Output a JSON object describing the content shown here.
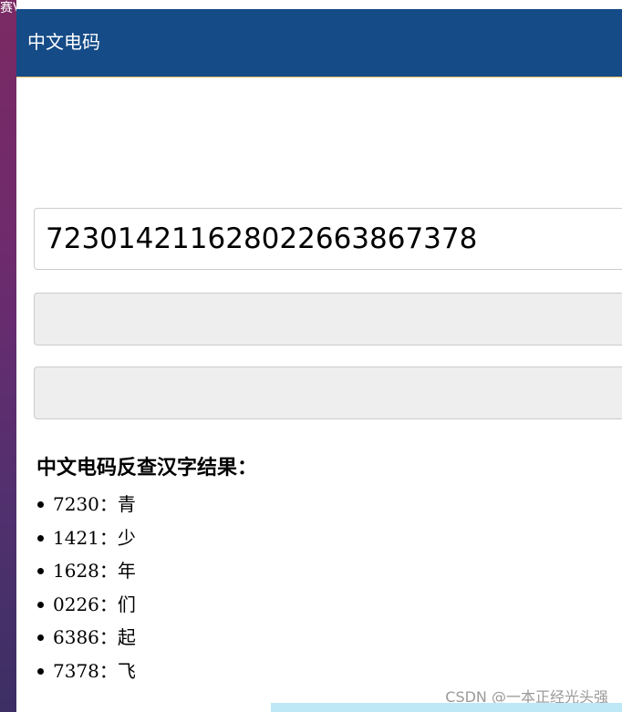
{
  "desktop": {
    "edge_text": "赛V"
  },
  "header": {
    "title": "中文电码",
    "background_color": "#154b86"
  },
  "form": {
    "code_input_value": "72301421162802266386737​8",
    "field2_value": "",
    "field3_value": ""
  },
  "result": {
    "title": "中文电码反查汉字结果：",
    "items": [
      {
        "label": "7230：青"
      },
      {
        "label": "1421：少"
      },
      {
        "label": "1628：年"
      },
      {
        "label": "0226：们"
      },
      {
        "label": "6386：起"
      },
      {
        "label": "7378：飞"
      }
    ]
  },
  "watermark": {
    "text": "CSDN @一本正经光头强"
  }
}
